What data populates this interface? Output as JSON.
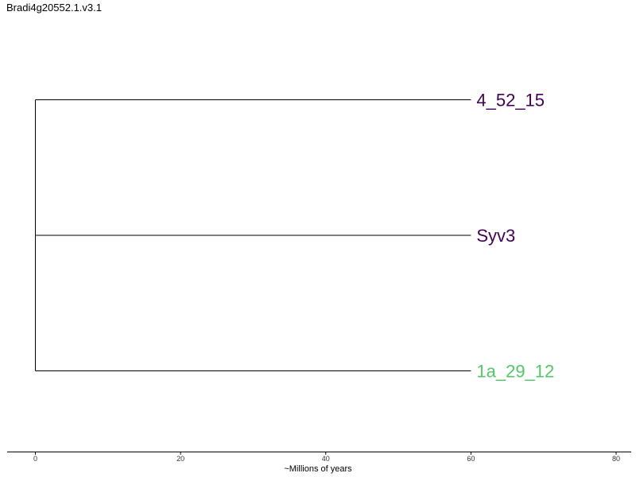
{
  "title": "Bradi4g20552.1.v3.1",
  "chart_data": {
    "type": "dendrogram",
    "xlabel": "~Millions of years",
    "xlim": [
      0,
      82
    ],
    "xticks": [
      "0",
      "20",
      "40",
      "60",
      "80"
    ],
    "root_x": 0,
    "leaves": [
      {
        "label": "4_52_15",
        "x": 60,
        "color": "#440154"
      },
      {
        "label": "Syv3",
        "x": 60,
        "color": "#440154"
      },
      {
        "label": "1a_29_12",
        "x": 60,
        "color": "#55c667"
      }
    ]
  }
}
